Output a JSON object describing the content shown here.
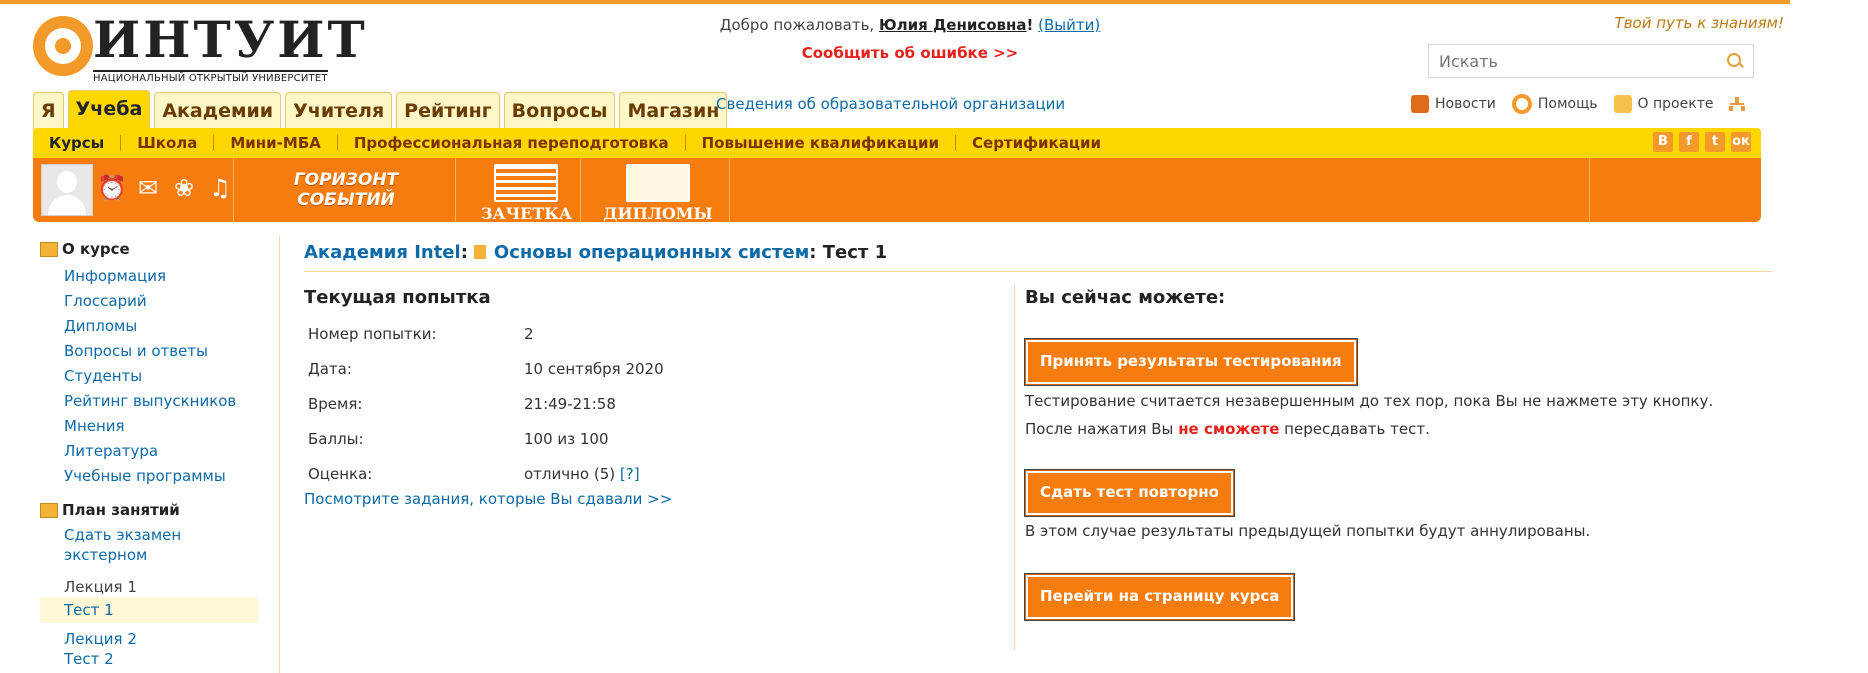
{
  "header": {
    "logo_name": "ИНТУИТ",
    "logo_sub": "НАЦИОНАЛЬНЫЙ ОТКРЫТЫЙ УНИВЕРСИТЕТ",
    "welcome_prefix": "Добро пожаловать,",
    "user_name": "Юлия Денисовна",
    "exclaim": "!",
    "logout": "(Выйти)",
    "report_error": "Сообщить об ошибке >>",
    "slogan": "Твой путь к знаниям!",
    "search_placeholder": "Искать"
  },
  "tabs": [
    "Я",
    "Учеба",
    "Академии",
    "Учителя",
    "Рейтинг",
    "Вопросы",
    "Магазин"
  ],
  "active_tab": "Учеба",
  "org_link": "Сведения об образовательной организации",
  "right_links": {
    "news": "Новости",
    "help": "Помощь",
    "about": "О проекте"
  },
  "subnav": [
    "Курсы",
    "Школа",
    "Мини-МБА",
    "Профессиональная переподготовка",
    "Повышение квалификации",
    "Сертификации"
  ],
  "social": [
    "В",
    "f",
    "t",
    "ок"
  ],
  "promo": {
    "horizon_1": "ГОРИЗОНТ",
    "horizon_2": "СОБЫТИЙ",
    "zachetka": "ЗАЧЕТКА",
    "diplomy": "ДИПЛОМЫ"
  },
  "sidebar": {
    "about_title": "О курсе",
    "about_items": [
      "Информация",
      "Глоссарий",
      "Дипломы",
      "Вопросы и ответы",
      "Студенты",
      "Рейтинг выпускников",
      "Мнения",
      "Литература",
      "Учебные программы"
    ],
    "plan_title": "План занятий",
    "plan_exam_1": "Сдать экзамен",
    "plan_exam_2": "экстерном",
    "lecture1": "Лекция 1",
    "test1": "Тест 1",
    "lecture2": "Лекция 2",
    "test2": "Тест 2"
  },
  "breadcrumb": {
    "academy": "Академия Intel",
    "colon1": ":",
    "course": "Основы операционных систем",
    "suffix": ": Тест 1"
  },
  "attempt": {
    "title": "Текущая попытка",
    "rows": [
      {
        "label": "Номер попытки:",
        "value": "2"
      },
      {
        "label": "Дата:",
        "value": "10 сентября 2020"
      },
      {
        "label": "Время:",
        "value": "21:49-21:58"
      },
      {
        "label": "Баллы:",
        "value": "100 из 100"
      },
      {
        "label": "Оценка:",
        "value": "отлично (5)"
      }
    ],
    "grade_hint": "[?]",
    "see_tasks": "Посмотрите задания, которые Вы сдавали >>"
  },
  "actions": {
    "title": "Вы сейчас можете:",
    "accept_btn": "Принять результаты тестирования",
    "accept_note": "Тестирование считается незавершенным до тех пор, пока Вы не нажмете эту кнопку.",
    "after_prefix": "После нажатия Вы",
    "after_red": "не сможете",
    "after_suffix": "пересдавать тест.",
    "retry_btn": "Сдать тест повторно",
    "retry_note": "В этом случае результаты предыдущей попытки будут аннулированы.",
    "course_btn": "Перейти на страницу курса"
  }
}
